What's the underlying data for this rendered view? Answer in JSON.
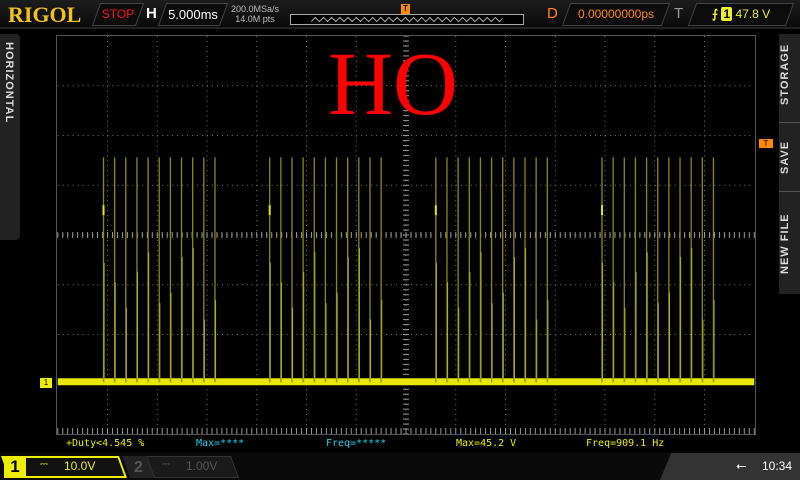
{
  "header": {
    "brand": "RIGOL",
    "run_state": "STOP",
    "h_label": "H",
    "timebase": "5.000ms",
    "sample_rate": "200.0MSa/s",
    "memory_depth": "14.0M pts",
    "trig_pos_marker": "T",
    "delay_label": "D",
    "delay": "0.00000000ps",
    "trigger_label": "T",
    "trigger_edge_icon": "rising-edge-icon",
    "trigger_source": "1",
    "trigger_level": "47.8 V"
  },
  "side": {
    "left_tab": "HORIZONTAL",
    "right_tabs": [
      "STORAGE",
      "SAVE",
      "NEW FILE"
    ]
  },
  "overlay_text": "HO",
  "markers": {
    "channel1": "1",
    "trigger_level": "T"
  },
  "waveform": {
    "color": "#e8e800",
    "groups": 4,
    "pulses_per_group": 11
  },
  "measurements": [
    {
      "text": "+Duty<4.545 %",
      "color": "#eeee00"
    },
    {
      "text": "Max=****",
      "color": "#22ccee"
    },
    {
      "text": "Freq=*****",
      "color": "#22ccee"
    },
    {
      "text": "Max=45.2 V",
      "color": "#eeee00"
    },
    {
      "text": "Freq=909.1 Hz",
      "color": "#eeee00"
    }
  ],
  "channels": [
    {
      "num": "1",
      "coupling": "⎓",
      "scale": "10.0V",
      "active": true
    },
    {
      "num": "2",
      "coupling": "⎓",
      "scale": "1.00V",
      "active": false
    }
  ],
  "status": {
    "usb_icon": "usb-icon",
    "time": "10:34"
  }
}
